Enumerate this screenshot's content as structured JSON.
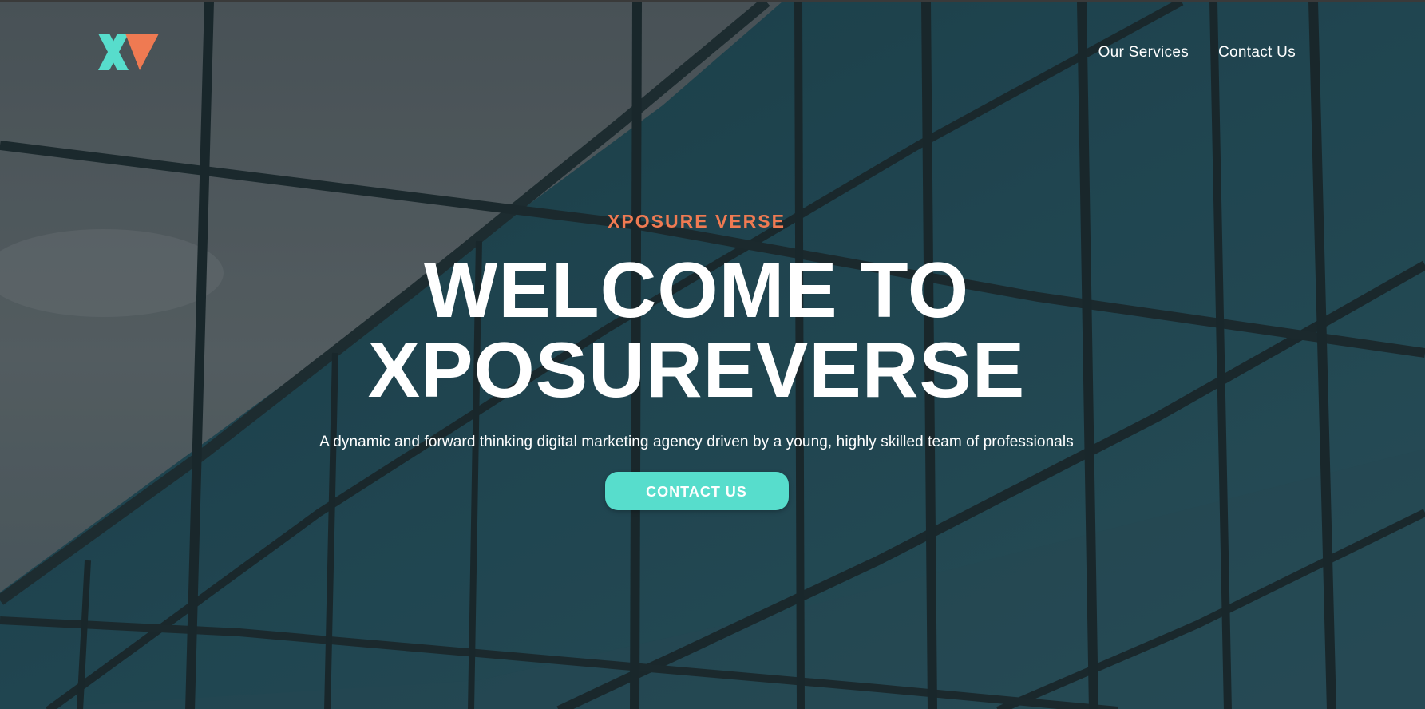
{
  "brand": {
    "logo_icon": "xv-logo-icon",
    "logo_colors": {
      "teal": "#57ddcc",
      "orange": "#ef7a52"
    }
  },
  "nav": {
    "items": [
      {
        "label": "Our Services"
      },
      {
        "label": "Contact Us"
      }
    ]
  },
  "hero": {
    "eyebrow": "XPOSURE VERSE",
    "headline_line1": "WELCOME TO",
    "headline_line2": "XPOSUREVERSE",
    "subtitle": "A dynamic and forward thinking digital marketing agency driven by a young, highly skilled team of professionals",
    "cta_label": "CONTACT US",
    "background": "glass-building-facade-image"
  },
  "colors": {
    "accent": "#57ddcc",
    "eyebrow": "#ef7a52",
    "text": "#ffffff"
  }
}
